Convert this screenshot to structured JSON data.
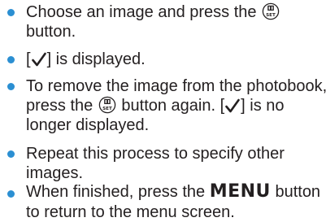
{
  "bullet_color": "#2b8fd2",
  "icons": [
    "func-set-button-icon",
    "checkmark-icon"
  ],
  "items": [
    {
      "line1_before": "Choose an image and press the",
      "line1_after": "",
      "line2": "button."
    },
    {
      "open": "[",
      "close": "] is displayed."
    },
    {
      "line1": "To remove the image from the photobook,",
      "line2_before": "press the",
      "line2_middle": "button again. [",
      "line2_after": "] is no",
      "line3": "longer displayed."
    },
    {
      "line1": "Repeat this process to specify other",
      "line2": "images."
    },
    {
      "line1_before": "When finished, press the",
      "menu_word": "MENU",
      "line1_after": "button",
      "line2": "to return to the menu screen."
    }
  ]
}
